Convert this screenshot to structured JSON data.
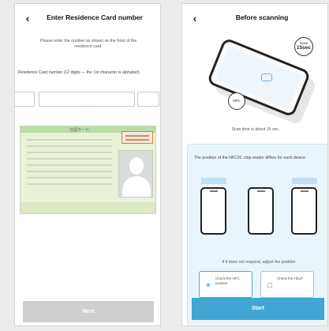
{
  "left_screen": {
    "title": "Enter Residence Card number",
    "back_icon": "chevron-left-icon",
    "info_text": "Please enter the number as shown on the front of the residence card.",
    "field_label": "Residence Card number (12 digits — the 1st character is alphabet)",
    "input_values": [
      "",
      "",
      ""
    ],
    "card": {
      "title": "在留カード"
    },
    "next_label": "Next"
  },
  "right_screen": {
    "title": "Before scanning",
    "back_icon": "chevron-left-icon",
    "badge_time_small": "Scan",
    "badge_time_big": "15sec",
    "badge_nfc": "NFC",
    "caption": "Scan time is about 15 sec.",
    "compat_title": "The position of the NFC/IC chip reader differs for each device",
    "compat_note": "If it does not respond, adjust the position",
    "options": [
      {
        "icon": "phone-nfc-icon",
        "label": "Check the NFC position"
      },
      {
        "icon": "help-card-icon",
        "label": "Check the HELP"
      }
    ],
    "start_label": "Start"
  }
}
